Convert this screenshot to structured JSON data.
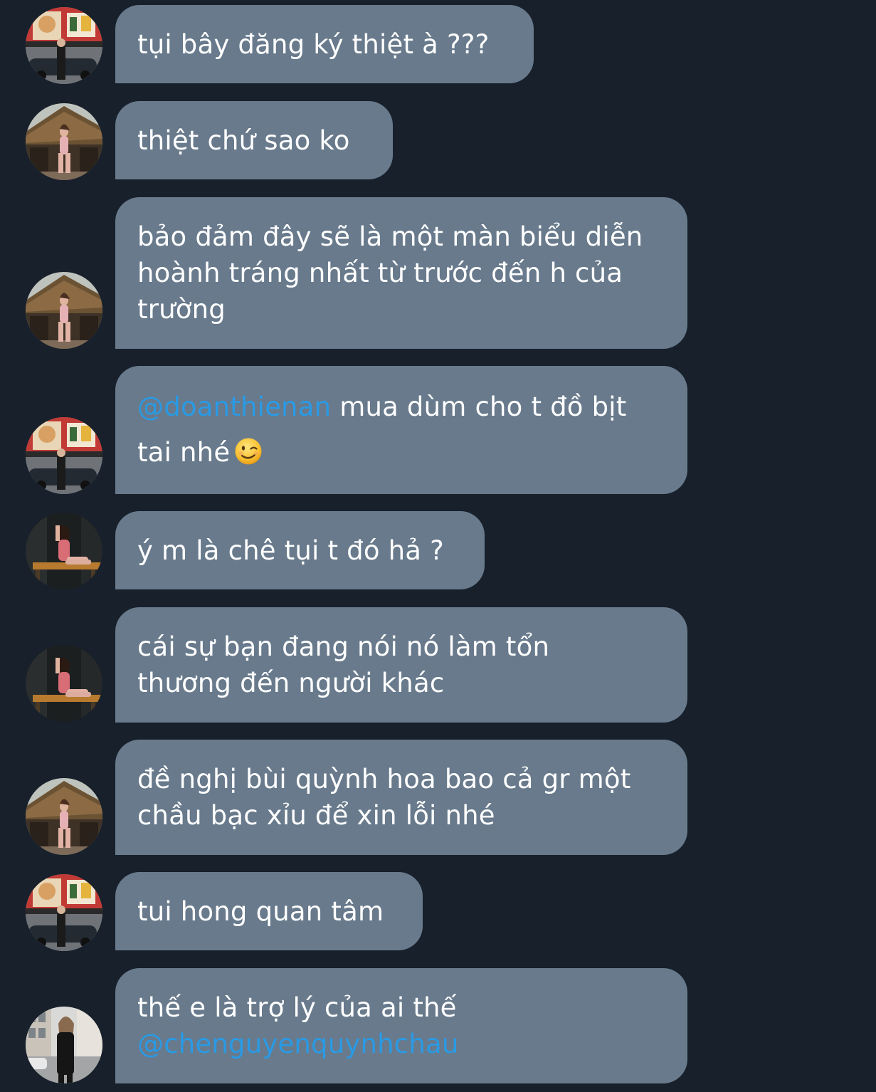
{
  "colors": {
    "background": "#17202b",
    "bubble": "#687a8c",
    "text": "#ffffff",
    "mention": "#2a9ae4"
  },
  "messages": [
    {
      "avatar": "avatar-street-poster",
      "lines": [
        "tụi bây đăng ký thiệt à ???"
      ]
    },
    {
      "avatar": "avatar-hut-pink",
      "lines": [
        "thiệt chứ sao ko"
      ]
    },
    {
      "avatar": "avatar-hut-pink",
      "lines": [
        "bảo đảm đây sẽ là một màn biểu diễn",
        "hoành tráng nhất từ trước đến h của",
        "trường"
      ]
    },
    {
      "avatar": "avatar-street-poster",
      "mention": "@doanthienan",
      "text_after_mention": " mua dùm cho t đồ bịt",
      "line2": "tai nhé",
      "emoji": "winking-face-emoji"
    },
    {
      "avatar": "avatar-dark-plaid",
      "lines": [
        "ý m là chê tụi t đó hả ?"
      ]
    },
    {
      "avatar": "avatar-dark-plaid",
      "lines": [
        "cái sự bạn đang nói nó làm tổn",
        "thương đến người khác"
      ]
    },
    {
      "avatar": "avatar-hut-pink",
      "lines": [
        "đề nghị bùi quỳnh hoa bao cả gr một",
        "chầu bạc xỉu để xin lỗi nhé"
      ]
    },
    {
      "avatar": "avatar-street-poster",
      "lines": [
        "tui hong quan tâm"
      ]
    },
    {
      "avatar": "avatar-city-black",
      "lines": [
        "thế e là trợ lý của ai thế"
      ],
      "mention": "@chenguyenquynhchau"
    }
  ]
}
